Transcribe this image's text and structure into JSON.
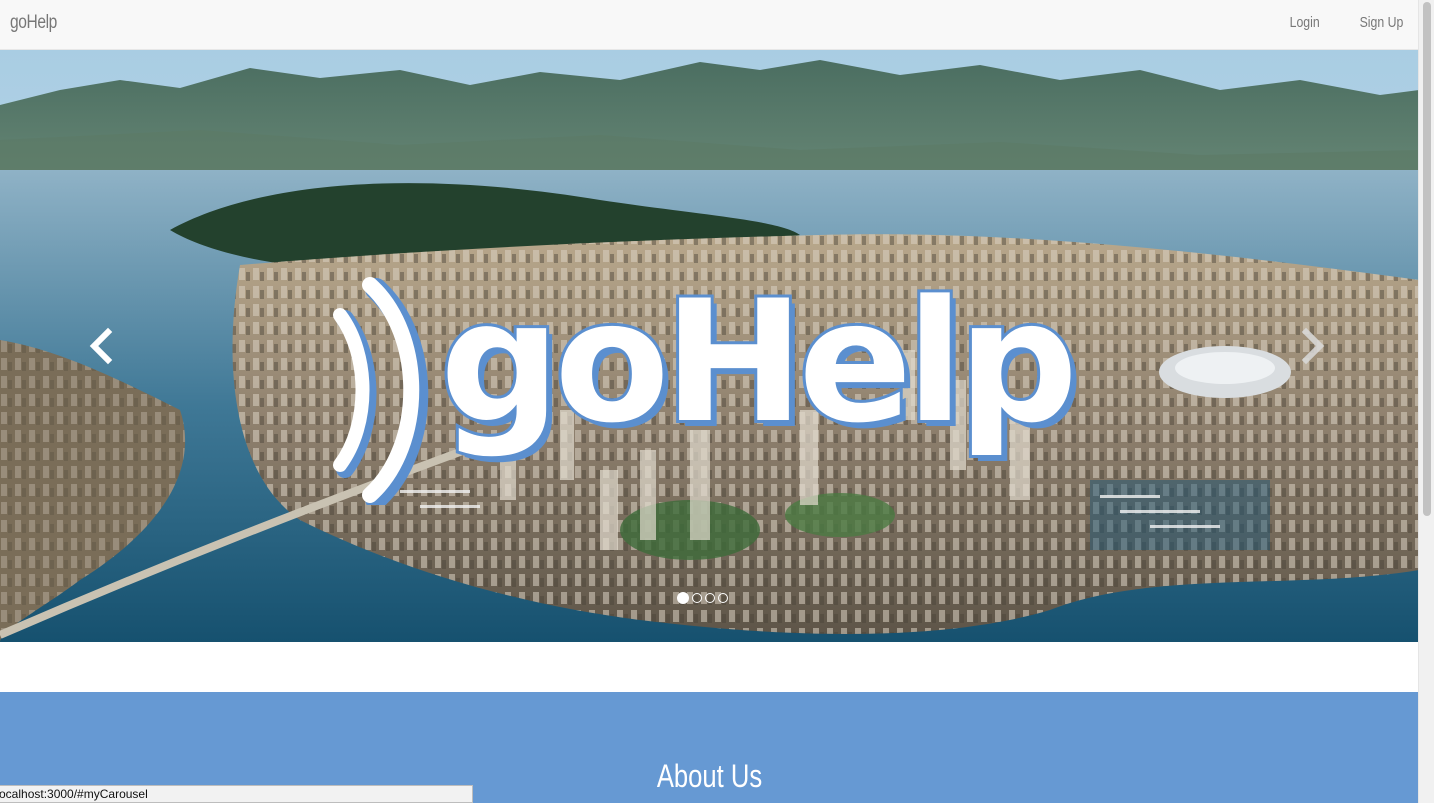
{
  "navbar": {
    "brand": "goHelp",
    "links": [
      "Login",
      "Sign Up"
    ]
  },
  "carousel": {
    "logo_text": "goHelp",
    "prev_icon": "chevron-left-icon",
    "next_icon": "chevron-right-icon",
    "slide_count": 4,
    "active_slide": 1
  },
  "about": {
    "title": "About Us"
  },
  "status_bar": {
    "url": "ocalhost:3000/#myCarousel"
  },
  "colors": {
    "accent_blue": "#6699d3",
    "navbar_bg": "#f8f8f8",
    "nav_text": "#777777"
  }
}
